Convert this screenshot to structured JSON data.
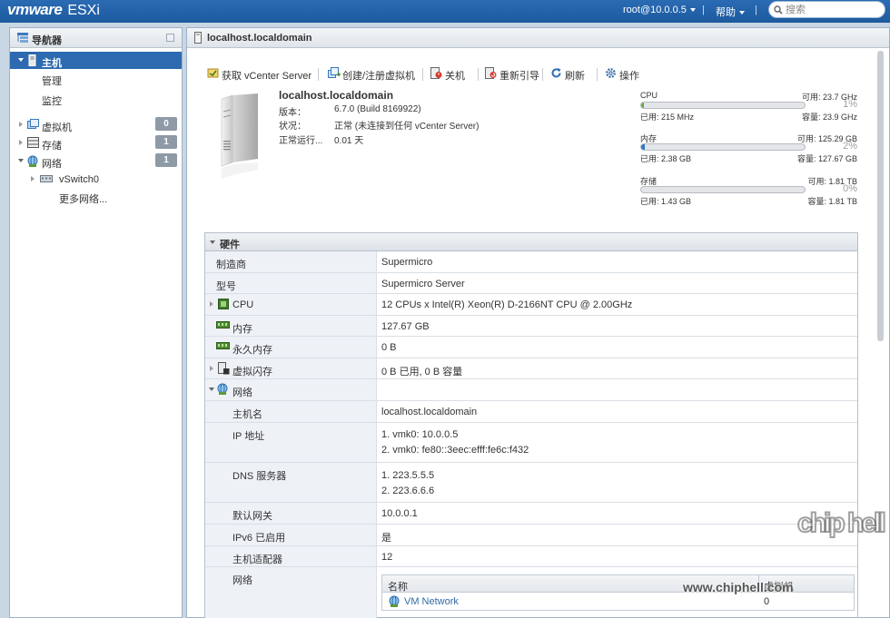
{
  "topbar": {
    "brand_vm": "vmware",
    "brand_esxi": "ESXi",
    "user": "root@10.0.0.5",
    "help": "帮助",
    "search_placeholder": "搜索"
  },
  "navigator": {
    "title": "导航器",
    "host_label": "主机",
    "manage": "管理",
    "monitor": "监控",
    "vms": {
      "label": "虚拟机",
      "count": "0"
    },
    "storage": {
      "label": "存储",
      "count": "1"
    },
    "network": {
      "label": "网络",
      "count": "1"
    },
    "vswitch": "vSwitch0",
    "more_networks": "更多网络..."
  },
  "main": {
    "title": "localhost.localdomain",
    "toolbar": {
      "get_vcenter": "获取 vCenter Server",
      "create_vm": "创建/注册虚拟机",
      "shutdown": "关机",
      "reboot": "重新引导",
      "refresh": "刷新",
      "actions": "操作"
    },
    "host": {
      "name": "localhost.localdomain",
      "version_label": "版本：",
      "version": "6.7.0 (Build 8169922)",
      "state_label": "状况：",
      "state": "正常 (未连接到任何 vCenter Server)",
      "uptime_label": "正常运行...",
      "uptime": "0.01 天"
    },
    "resources": [
      {
        "name": "CPU",
        "available": "可用: 23.7 GHz",
        "percent": "1%",
        "fraction": 0.01,
        "used": "已用: 215 MHz",
        "capacity": "容量: 23.9 GHz"
      },
      {
        "name": "内存",
        "available": "可用: 125.29 GB",
        "percent": "2%",
        "fraction": 0.02,
        "used": "已用: 2.38 GB",
        "capacity": "容量: 127.67 GB"
      },
      {
        "name": "存储",
        "available": "可用: 1.81 TB",
        "percent": "0%",
        "fraction": 0.0,
        "used": "已用: 1.43 GB",
        "capacity": "容量: 1.81 TB"
      }
    ],
    "hardware": {
      "title": "硬件",
      "manufacturer_label": "制造商",
      "manufacturer": "Supermicro",
      "model_label": "型号",
      "model": "Supermicro Server",
      "cpu_label": "CPU",
      "cpu": "12 CPUs x Intel(R) Xeon(R) D-2166NT CPU @ 2.00GHz",
      "memory_label": "内存",
      "memory": "127.67 GB",
      "pmem_label": "永久内存",
      "pmem": "0 B",
      "vflash_label": "虚拟闪存",
      "vflash": "0 B 已用, 0 B 容量",
      "network_label": "网络",
      "hostname_label": "主机名",
      "hostname": "localhost.localdomain",
      "ip_label": "IP 地址",
      "ip1": "1. vmk0: 10.0.0.5",
      "ip2": "2. vmk0: fe80::3eec:efff:fe6c:f432",
      "dns_label": "DNS 服务器",
      "dns1": "1. 223.5.5.5",
      "dns2": "2. 223.6.6.6",
      "gateway_label": "默认网关",
      "gateway": "10.0.0.1",
      "ipv6_label": "IPv6 已启用",
      "ipv6": "是",
      "adapters_label": "主机适配器",
      "adapters": "12",
      "networks_label": "网络",
      "networks_table": {
        "col_name": "名称",
        "col_vms": "虚拟机",
        "rows": [
          {
            "name": "VM Network",
            "vms": "0"
          }
        ]
      }
    }
  },
  "watermark": {
    "logo": "chip hell",
    "url": "www.chiphell.com"
  },
  "colors": {
    "topbar": "#1d5a9f",
    "selection": "#2d6ab0",
    "cpu_bar": "#5fae3f",
    "mem_bar": "#2f78c5"
  }
}
